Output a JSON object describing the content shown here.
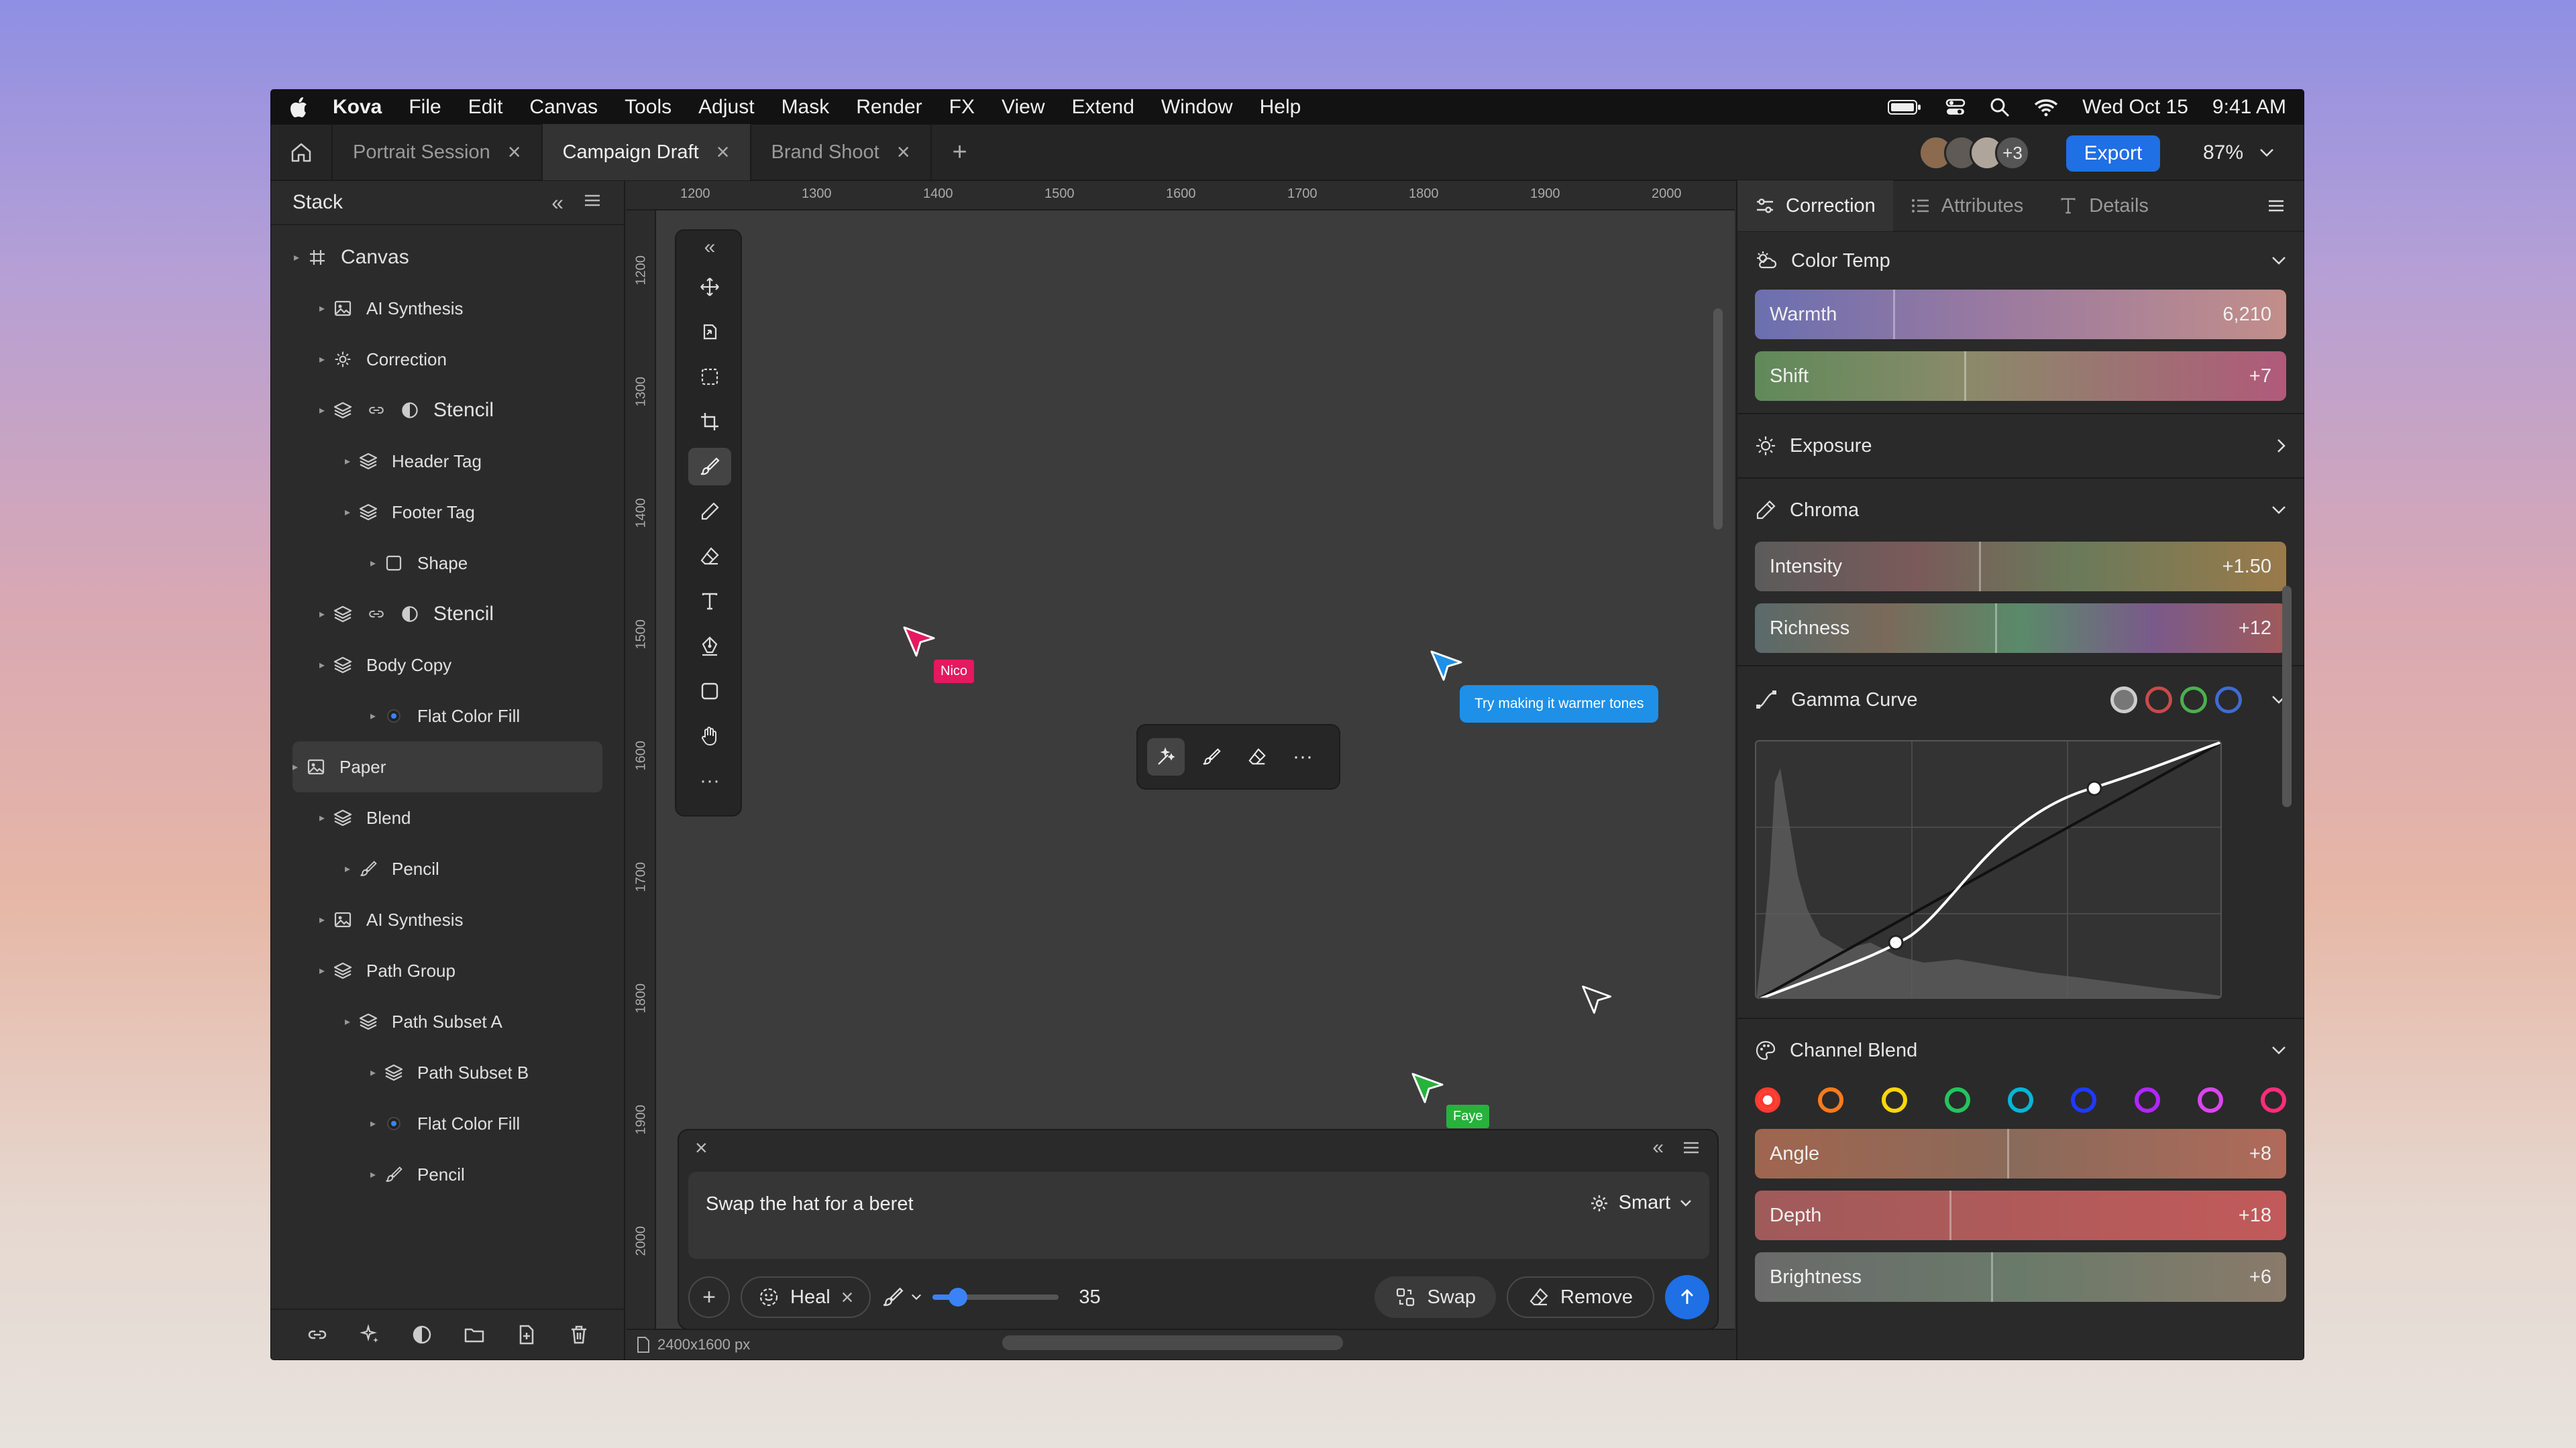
{
  "menubar": {
    "app": "Kova",
    "items": [
      "File",
      "Edit",
      "Canvas",
      "Tools",
      "Adjust",
      "Mask",
      "Render",
      "FX",
      "View",
      "Extend",
      "Window",
      "Help"
    ],
    "date": "Wed Oct 15",
    "time": "9:41 AM",
    "icons": [
      "battery-icon",
      "control-center-icon",
      "search-icon",
      "wifi-icon"
    ]
  },
  "tabs": [
    {
      "label": "Portrait Session",
      "active": false
    },
    {
      "label": "Campaign Draft",
      "active": true
    },
    {
      "label": "Brand Shoot",
      "active": false
    }
  ],
  "collab": {
    "more": "+3"
  },
  "export_label": "Export",
  "zoom": "87%",
  "stack": {
    "title": "Stack",
    "layers": [
      {
        "label": "Canvas",
        "icon": "frame-icon",
        "indent": 0,
        "big": true
      },
      {
        "label": "AI Synthesis",
        "icon": "image-icon",
        "indent": 1
      },
      {
        "label": "Correction",
        "icon": "sun-icon",
        "indent": 1
      },
      {
        "label": "Stencil",
        "icon": "layers-icon",
        "indent": 1,
        "big": true,
        "mask": true
      },
      {
        "label": "Header Tag",
        "icon": "layers-icon",
        "indent": 2
      },
      {
        "label": "Footer Tag",
        "icon": "layers-icon",
        "indent": 2
      },
      {
        "label": "Shape",
        "icon": "square-icon",
        "indent": 3
      },
      {
        "label": "Stencil",
        "icon": "layers-icon",
        "indent": 1,
        "big": true,
        "mask": true
      },
      {
        "label": "Body Copy",
        "icon": "layers-icon",
        "indent": 1
      },
      {
        "label": "Flat Color Fill",
        "icon": "dot-icon",
        "indent": 3
      },
      {
        "label": "Paper",
        "icon": "image-icon",
        "indent": 1,
        "selected": true
      },
      {
        "label": "Blend",
        "icon": "layers-icon",
        "indent": 1
      },
      {
        "label": "Pencil",
        "icon": "brush-icon",
        "indent": 2
      },
      {
        "label": "AI Synthesis",
        "icon": "image-icon",
        "indent": 1
      },
      {
        "label": "Path Group",
        "icon": "layers-icon",
        "indent": 1
      },
      {
        "label": "Path Subset A",
        "icon": "layers-icon",
        "indent": 2
      },
      {
        "label": "Path Subset B",
        "icon": "layers-icon",
        "indent": 3
      },
      {
        "label": "Flat Color Fill",
        "icon": "dot-icon",
        "indent": 3
      },
      {
        "label": "Pencil",
        "icon": "brush-icon",
        "indent": 3
      }
    ]
  },
  "ruler": {
    "x": [
      "1200",
      "1300",
      "1400",
      "1500",
      "1600",
      "1700",
      "1800",
      "1900",
      "2000"
    ],
    "y": [
      "1200",
      "1300",
      "1400",
      "1500",
      "1600",
      "1700",
      "1800",
      "1900",
      "2000"
    ]
  },
  "collaborators": {
    "nico": "Nico",
    "faye": "Faye",
    "comment": "Try making it warmer tones"
  },
  "prompt": {
    "text": "Swap the hat for a beret",
    "mode": "Smart",
    "heal": "Heal",
    "brush_size": "35",
    "brush_fraction": 0.2,
    "swap": "Swap",
    "remove": "Remove"
  },
  "status": "2400x1600 px",
  "inspector": {
    "tabs": [
      "Correction",
      "Attributes",
      "Details"
    ],
    "color_temp": {
      "title": "Color Temp",
      "warmth": {
        "label": "Warmth",
        "value": "6,210"
      },
      "shift": {
        "label": "Shift",
        "value": "+7"
      }
    },
    "exposure": {
      "title": "Exposure"
    },
    "chroma": {
      "title": "Chroma",
      "intensity": {
        "label": "Intensity",
        "value": "+1.50"
      },
      "richness": {
        "label": "Richness",
        "value": "+12"
      }
    },
    "gamma": {
      "title": "Gamma Curve"
    },
    "channel_blend": {
      "title": "Channel Blend",
      "swatches": [
        "#ff3b30",
        "#ff7a1a",
        "#ffd60a",
        "#22c55e",
        "#06b6d4",
        "#1e3aff",
        "#b026ff",
        "#d946ef",
        "#ff2d78"
      ],
      "angle": {
        "label": "Angle",
        "value": "+8"
      },
      "depth": {
        "label": "Depth",
        "value": "+18"
      },
      "brightness": {
        "label": "Brightness",
        "value": "+6"
      }
    }
  },
  "colors": {
    "accent": "#1f6fe5",
    "nico": "#e5195f",
    "faye": "#27b23c",
    "comment": "#1e90e8"
  }
}
